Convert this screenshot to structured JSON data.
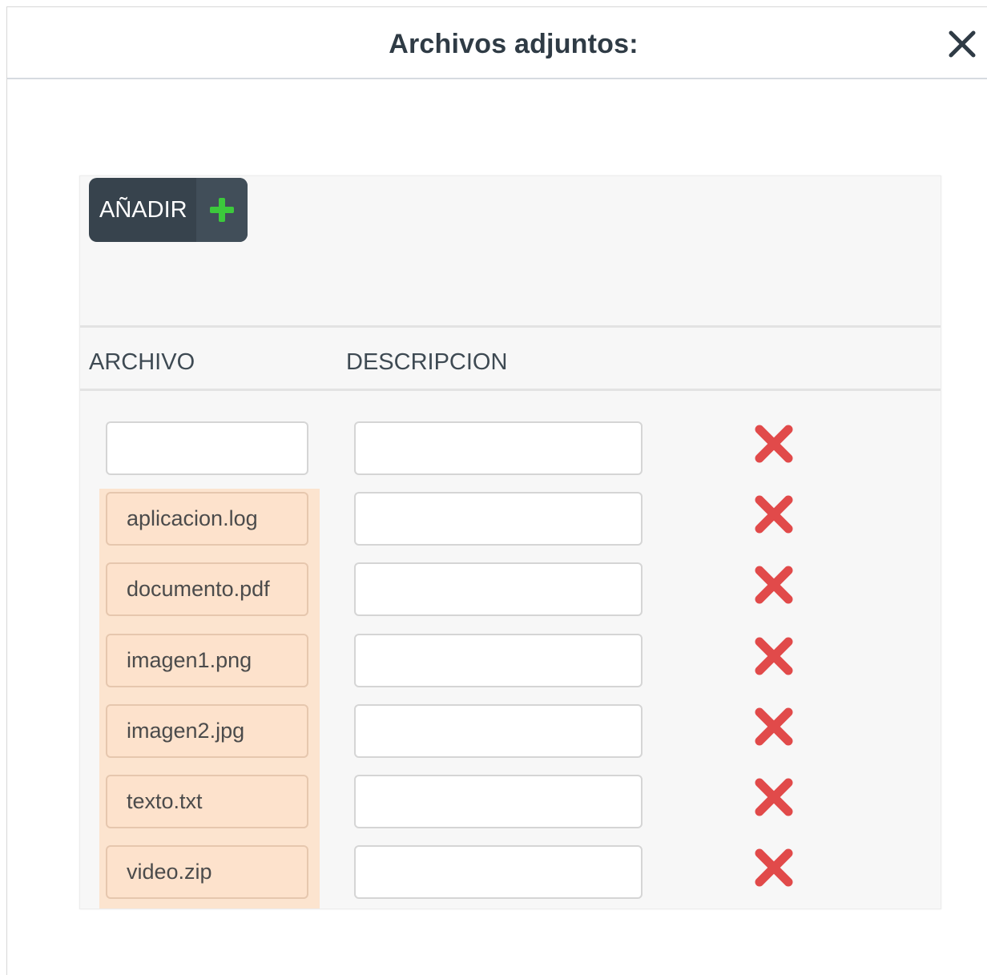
{
  "dialog": {
    "title": "Archivos adjuntos:",
    "close_icon": "close-icon"
  },
  "toolbar": {
    "add_label": "AÑADIR",
    "add_icon": "plus-icon",
    "add_icon_color": "#3cc93c"
  },
  "table": {
    "headers": {
      "file": "ARCHIVO",
      "description": "DESCRIPCION"
    },
    "rows": [
      {
        "file": "",
        "description": ""
      },
      {
        "file": "aplicacion.log",
        "description": ""
      },
      {
        "file": "documento.pdf",
        "description": ""
      },
      {
        "file": "imagen1.png",
        "description": ""
      },
      {
        "file": "imagen2.jpg",
        "description": ""
      },
      {
        "file": "texto.txt",
        "description": ""
      },
      {
        "file": "video.zip",
        "description": ""
      }
    ],
    "delete_icon": "delete-x-icon",
    "delete_icon_color": "#e14a4a",
    "highlight_color": "#fce4cf"
  }
}
